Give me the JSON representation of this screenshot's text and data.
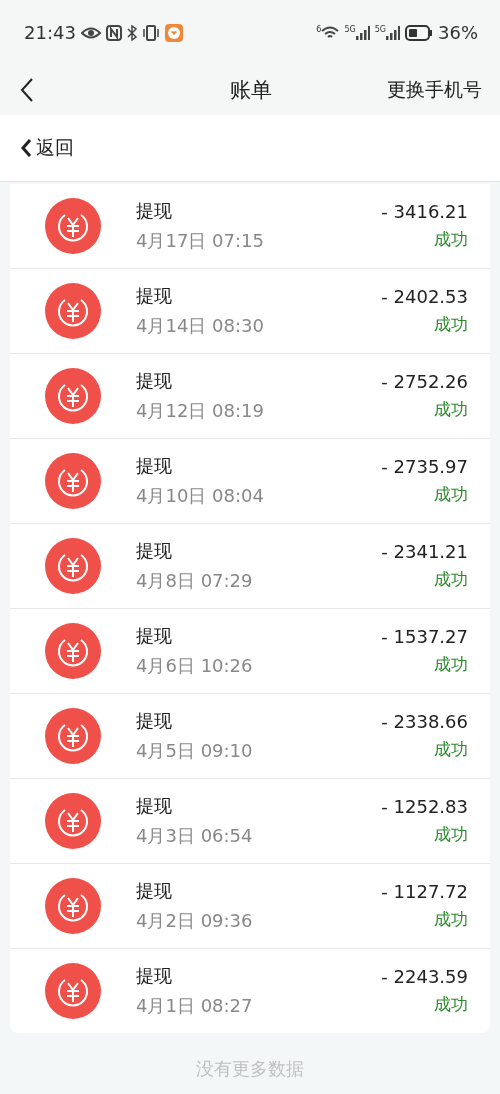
{
  "status_bar": {
    "time": "21:43",
    "signal_labels": [
      "6",
      "5G",
      "5G"
    ],
    "battery": "36%"
  },
  "nav": {
    "title": "账单",
    "action": "更换手机号"
  },
  "back_bar": {
    "label": "返回"
  },
  "transactions": [
    {
      "title": "提现",
      "date": "4月17日 07:15",
      "amount": "- 3416.21",
      "status": "成功"
    },
    {
      "title": "提现",
      "date": "4月14日 08:30",
      "amount": "- 2402.53",
      "status": "成功"
    },
    {
      "title": "提现",
      "date": "4月12日 08:19",
      "amount": "- 2752.26",
      "status": "成功"
    },
    {
      "title": "提现",
      "date": "4月10日 08:04",
      "amount": "- 2735.97",
      "status": "成功"
    },
    {
      "title": "提现",
      "date": "4月8日 07:29",
      "amount": "- 2341.21",
      "status": "成功"
    },
    {
      "title": "提现",
      "date": "4月6日 10:26",
      "amount": "- 1537.27",
      "status": "成功"
    },
    {
      "title": "提现",
      "date": "4月5日 09:10",
      "amount": "- 2338.66",
      "status": "成功"
    },
    {
      "title": "提现",
      "date": "4月3日 06:54",
      "amount": "- 1252.83",
      "status": "成功"
    },
    {
      "title": "提现",
      "date": "4月2日 09:36",
      "amount": "- 1127.72",
      "status": "成功"
    },
    {
      "title": "提现",
      "date": "4月1日 08:27",
      "amount": "- 2243.59",
      "status": "成功"
    }
  ],
  "footer": "没有更多数据"
}
